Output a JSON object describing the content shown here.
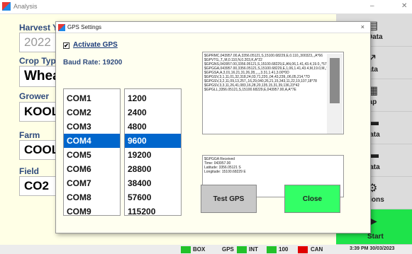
{
  "window": {
    "title": "Analysis",
    "minimize": "–",
    "close": "✕"
  },
  "form": {
    "harvest_label": "Harvest Year",
    "harvest_value": "2022",
    "crop_label": "Crop Type",
    "crop_value": "Wheat",
    "grower_label": "Grower",
    "grower_value": "KOOL",
    "farm_label": "Farm",
    "farm_value": "COOL",
    "field_label": "Field",
    "field_value": "CO2"
  },
  "sidebar": [
    {
      "label": "etup Data",
      "icon": "notebook-icon",
      "glyph": "▤"
    },
    {
      "label": "eld Data",
      "icon": "chart-icon",
      "glyph": "↗"
    },
    {
      "label": "eld Map",
      "icon": "map-icon",
      "glyph": "▦"
    },
    {
      "label": "ank Data",
      "icon": "harvester-icon",
      "glyph": "▬"
    },
    {
      "label": "uck Data",
      "icon": "truck-icon",
      "glyph": "▬"
    },
    {
      "label": "Options",
      "icon": "gear-icon",
      "glyph": "⚙"
    },
    {
      "label": "Start",
      "icon": "play-icon",
      "glyph": "▶"
    }
  ],
  "statusbar": {
    "box": "BOX",
    "gps": "GPS",
    "int": "INT",
    "v100": "100",
    "can": "CAN",
    "datetime": "3:39 PM 30/03/2023",
    "ok_color": "#22c22a",
    "alert_color": "#e00000"
  },
  "dialog": {
    "title": "GPS Settings",
    "close": "×",
    "activate_label": "Activate GPS",
    "activate_checked": "✔",
    "baud_label": "Baud Rate: 19200",
    "ports": [
      "COM1",
      "COM2",
      "COM3",
      "COM4",
      "COM5",
      "COM6",
      "COM7",
      "COM8",
      "COM9"
    ],
    "ports_selected": 3,
    "bauds": [
      "1200",
      "2400",
      "4800",
      "9600",
      "19200",
      "28800",
      "38400",
      "57600",
      "115200"
    ],
    "bauds_selected": 3,
    "nmea_lines": [
      "$GPRMC,043957.00,A,3356.05121,S,15100.68229,E,0.110,,300323,,,A*66",
      "$GPVTG,,T,,M,0.110,N,0.203,K,A*22",
      "$GPGNS,043957.00,3356.05121,S,15100.68229,E,AN,06,1.41,43.4,19.0,,*57",
      "$GPGGA,043957.00,3356.05121,S,15100.68229,E,1,06,1.41,43.4,M,19.0,M,,*72",
      "$GPGSA,A,3,01,16,21,31,26,28,,,,,,3.31,1.41,3.00*0D",
      "$GPGSV,3,1,11,01,32,318,24,03,71,220,,04,43,239,,06,05,214,*7D",
      "$GPGSV,3,2,11,09,13,257,,16,29,040,26,21,15,343,11,22,19,107,18*78",
      "$GPGSV,3,3,11,26,41,083,16,28,20,135,15,31,39,136,23*42",
      "$GPGLL,3356.05121,S,15100.68229,E,043957.00,A,A*7E"
    ],
    "gps_received": "$GPGGA Received",
    "time_line": "Time: 043957.00",
    "lat_line": "Latitude: 3356.05121 S",
    "lon_line": "Longitude: 15100.68229 E",
    "test_button": "Test GPS",
    "close_button": "Close"
  }
}
